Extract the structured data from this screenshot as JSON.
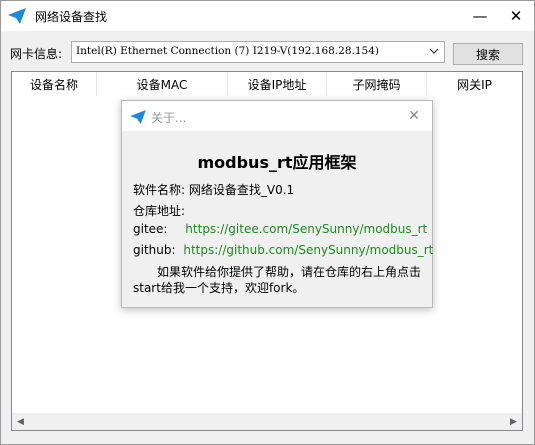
{
  "window": {
    "title": "网络设备查找",
    "min_glyph": "—",
    "close_glyph": "✕"
  },
  "toolbar": {
    "nic_label": "网卡信息:",
    "nic_value": "Intel(R) Ethernet Connection (7) I219-V(192.168.28.154)",
    "search_label": "搜索"
  },
  "table": {
    "columns": [
      "设备名称",
      "设备MAC",
      "设备IP地址",
      "子网掩码",
      "网关IP"
    ],
    "rows": []
  },
  "about": {
    "title": "关于...",
    "close_glyph": "✕",
    "heading": "modbus_rt应用框架",
    "software_line": "软件名称: 网络设备查找_V0.1",
    "repo_label": "仓库地址:",
    "gitee_label": "gitee:",
    "gitee_url": "https://gitee.com/SenySunny/modbus_rt",
    "github_label": "github:",
    "github_url": "https://github.com/SenySunny/modbus_rt",
    "description": "如果软件给你提供了帮助，请在仓库的右上角点击start给我一个支持，欢迎fork。"
  },
  "colors": {
    "accent": "#1e88e5",
    "link": "#1e8c1e"
  },
  "icons": {
    "app": "paper-plane-icon",
    "dropdown": "chevron-down-icon",
    "scroll_left": "chevron-left-icon",
    "scroll_right": "chevron-right-icon"
  }
}
